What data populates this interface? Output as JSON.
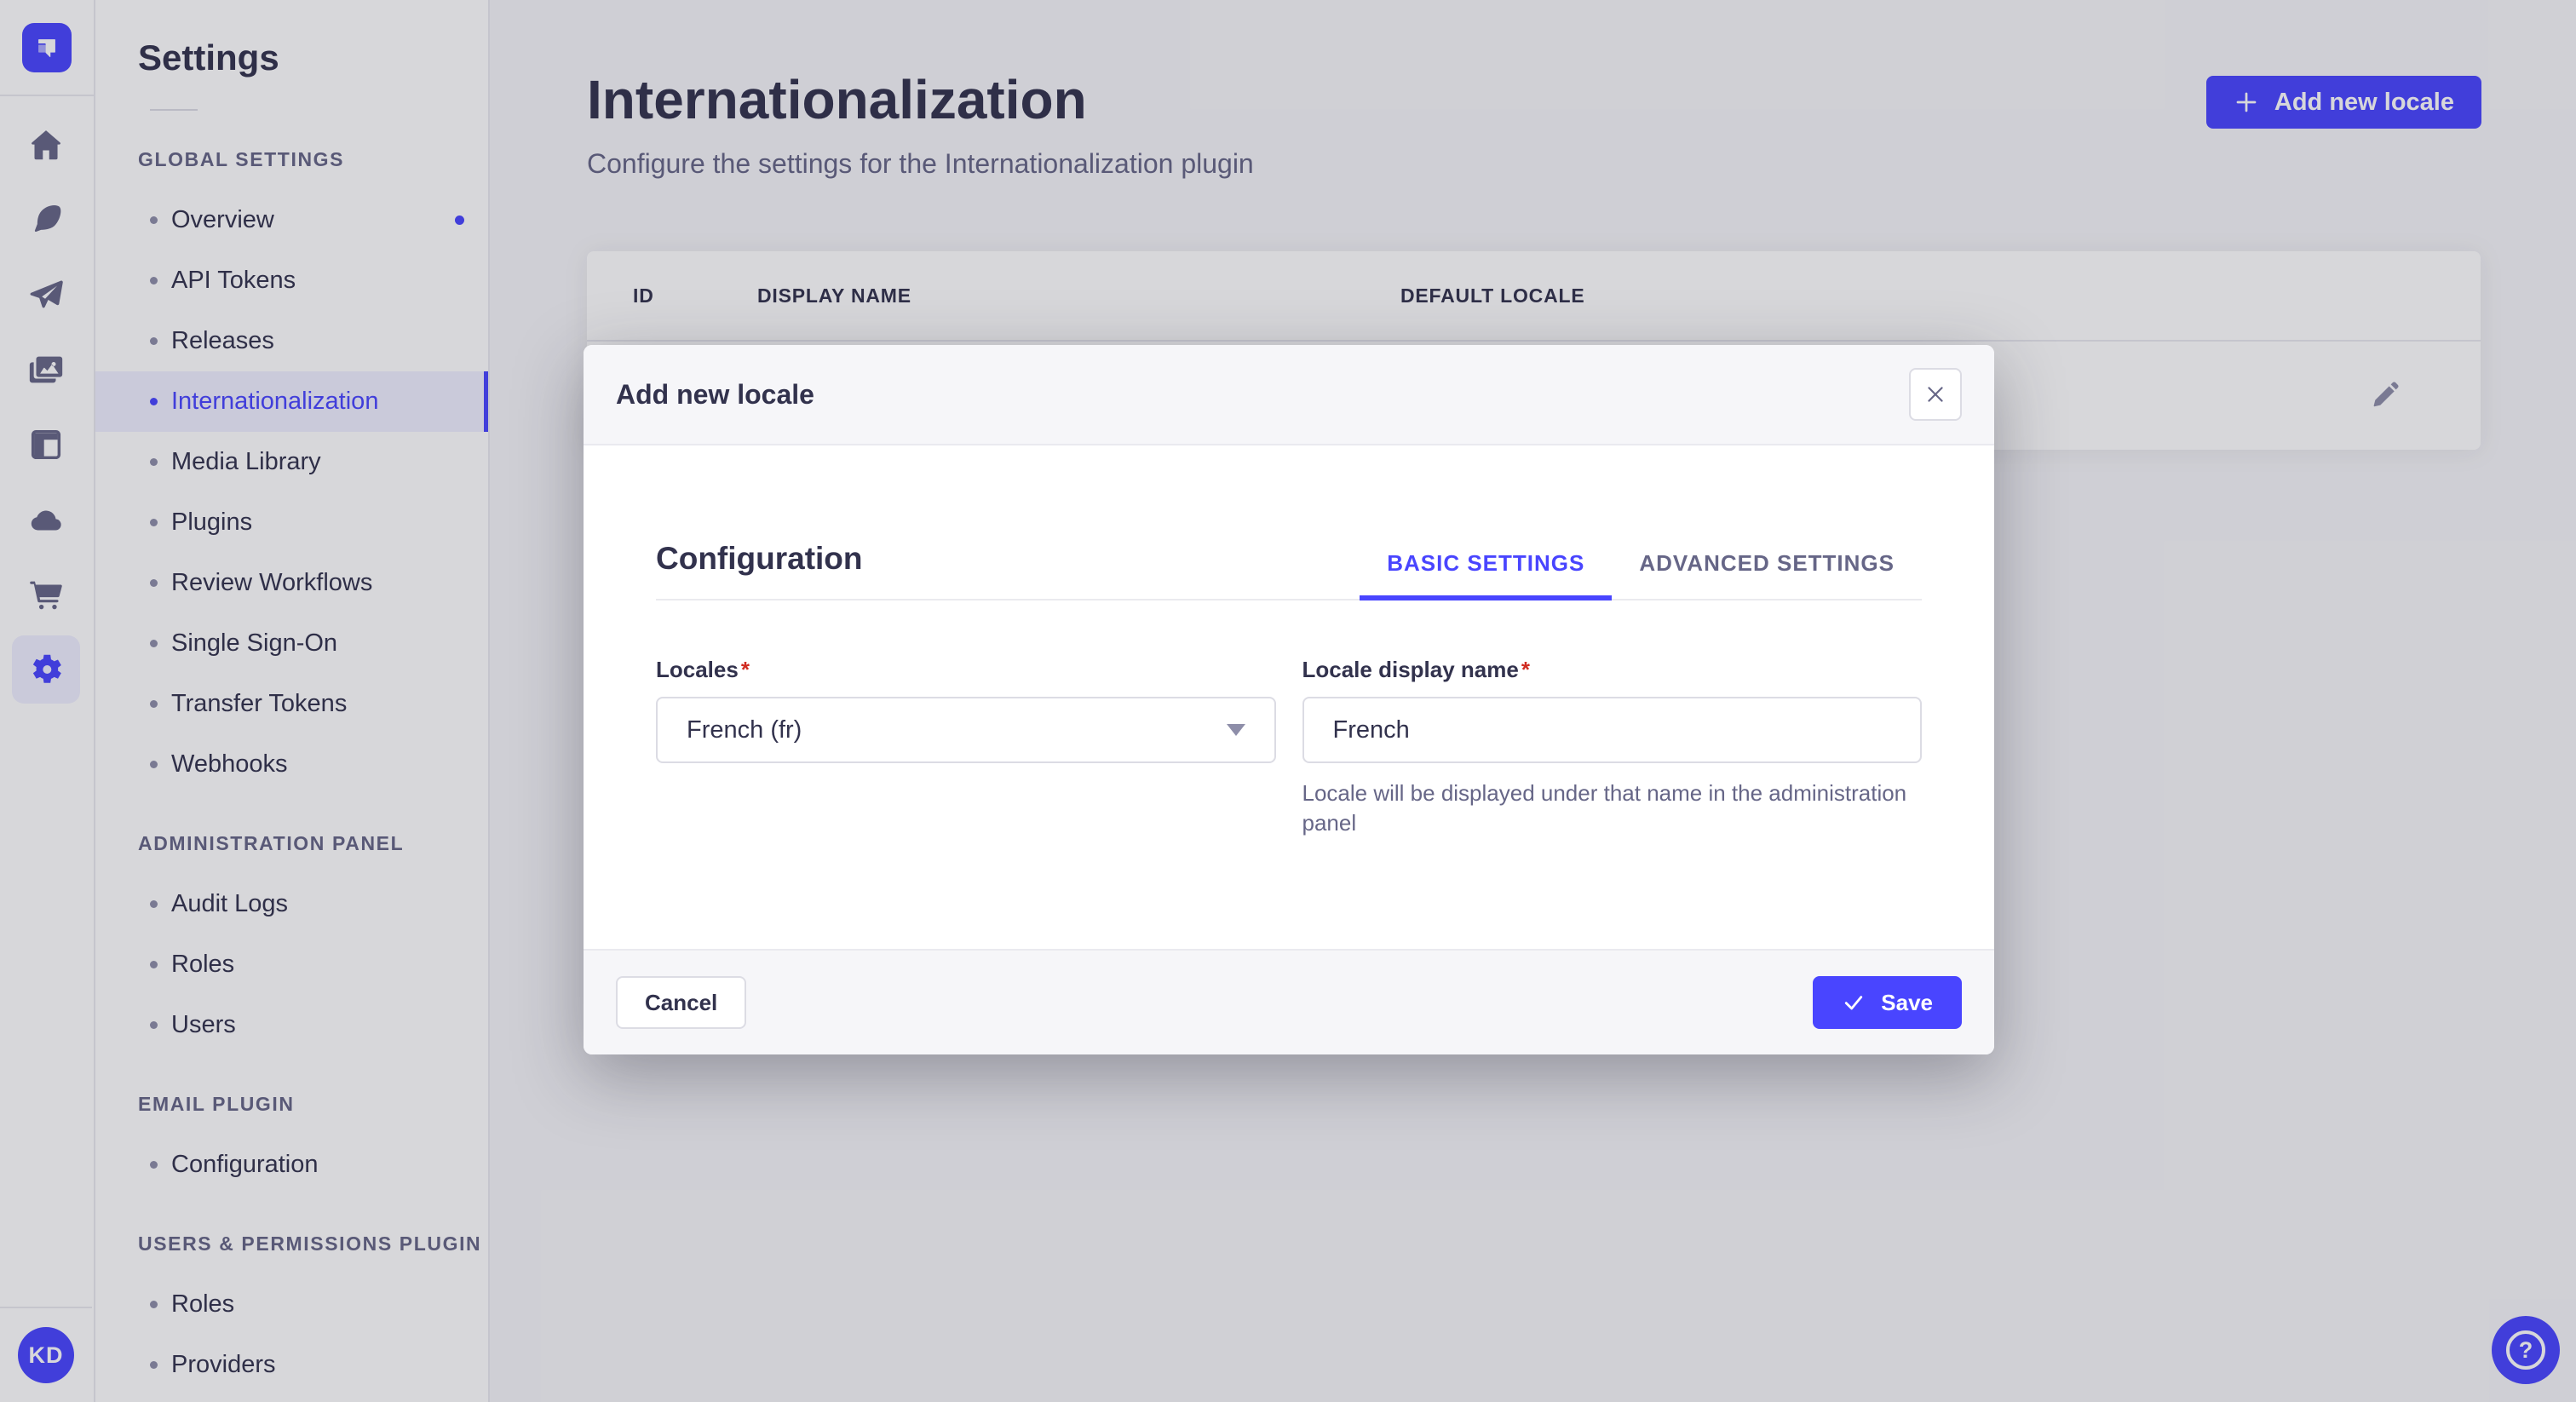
{
  "colors": {
    "primary": "#4945ff",
    "primary_light": "#f0f0ff",
    "text": "#32324d",
    "text_muted": "#666687",
    "text_soft": "#8e8ea9",
    "border": "#dcdce4",
    "border_light": "#eaeaef",
    "page_bg": "#f6f6f9",
    "danger": "#d02b20"
  },
  "rail": {
    "logo_icon": "strapi-logo",
    "icons": [
      "home-icon",
      "content-type-builder-icon",
      "send-icon",
      "media-library-icon",
      "content-manager-icon",
      "cloud-icon",
      "marketplace-icon",
      "settings-icon"
    ],
    "active_icon": "settings-icon",
    "avatar_initials": "KD"
  },
  "sidebar": {
    "title": "Settings",
    "sections": [
      {
        "label": "GLOBAL SETTINGS",
        "items": [
          {
            "label": "Overview",
            "notification": true
          },
          {
            "label": "API Tokens"
          },
          {
            "label": "Releases"
          },
          {
            "label": "Internationalization",
            "active": true
          },
          {
            "label": "Media Library"
          },
          {
            "label": "Plugins"
          },
          {
            "label": "Review Workflows"
          },
          {
            "label": "Single Sign-On"
          },
          {
            "label": "Transfer Tokens"
          },
          {
            "label": "Webhooks"
          }
        ]
      },
      {
        "label": "ADMINISTRATION PANEL",
        "items": [
          {
            "label": "Audit Logs"
          },
          {
            "label": "Roles"
          },
          {
            "label": "Users"
          }
        ]
      },
      {
        "label": "EMAIL PLUGIN",
        "items": [
          {
            "label": "Configuration"
          }
        ]
      },
      {
        "label": "USERS & PERMISSIONS PLUGIN",
        "items": [
          {
            "label": "Roles"
          },
          {
            "label": "Providers"
          }
        ]
      }
    ]
  },
  "header": {
    "title": "Internationalization",
    "subtitle": "Configure the settings for the Internationalization plugin",
    "add_button_label": "Add new locale"
  },
  "table": {
    "columns": [
      "ID",
      "DISPLAY NAME",
      "DEFAULT LOCALE"
    ],
    "row_action_icon": "pencil-icon"
  },
  "modal": {
    "title": "Add new locale",
    "close_icon": "close-icon",
    "section_title": "Configuration",
    "tabs": [
      {
        "label": "BASIC SETTINGS",
        "active": true
      },
      {
        "label": "ADVANCED SETTINGS",
        "active": false
      }
    ],
    "required_mark": "*",
    "fields": {
      "locales": {
        "label": "Locales",
        "value": "French (fr)"
      },
      "display_name": {
        "label": "Locale display name",
        "value": "French",
        "help": "Locale will be displayed under that name in the administration panel"
      }
    },
    "cancel_label": "Cancel",
    "save_label": "Save"
  },
  "help": {
    "icon": "question-icon",
    "glyph": "?"
  }
}
